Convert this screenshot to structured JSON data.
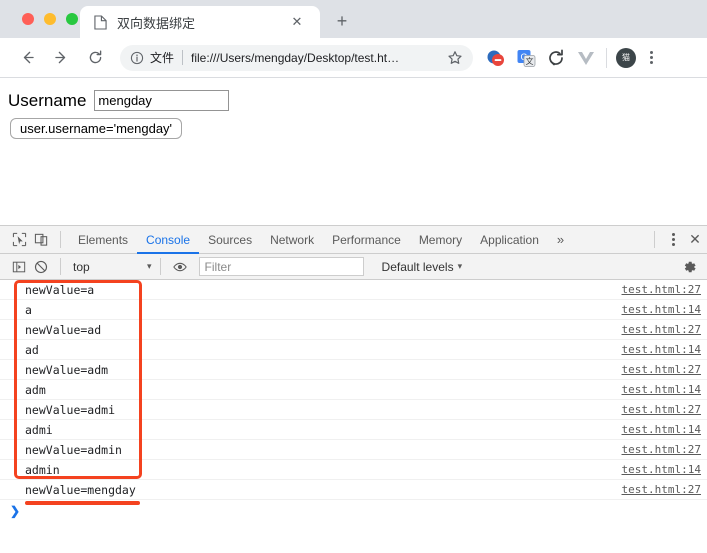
{
  "browser": {
    "tab": {
      "title": "双向数据绑定",
      "favicon_icon": "document-icon",
      "close_icon": "close-icon"
    },
    "new_tab_label": "+",
    "nav": {
      "back_icon": "arrow-left-icon",
      "forward_icon": "arrow-right-icon",
      "reload_icon": "reload-icon"
    },
    "omnibox": {
      "info_icon": "info-circle-icon",
      "scheme_label": "文件",
      "url": "file:///Users/mengday/Desktop/test.ht…",
      "star_icon": "star-icon"
    },
    "extensions": [
      {
        "name": "adblock-extension-icon"
      },
      {
        "name": "google-translate-extension-icon"
      },
      {
        "name": "refresh-extension-icon"
      },
      {
        "name": "vue-devtools-extension-icon"
      }
    ],
    "avatar_initial": "猫",
    "menu_icon": "kebab-menu-icon"
  },
  "page": {
    "username_label": "Username",
    "username_value": "mengday",
    "username_placeholder": "",
    "expression_text": "user.username='mengday'"
  },
  "devtools": {
    "inspect_icon": "inspect-element-icon",
    "device_toolbar_icon": "device-toolbar-icon",
    "tabs": [
      {
        "label": "Elements",
        "active": false
      },
      {
        "label": "Console",
        "active": true
      },
      {
        "label": "Sources",
        "active": false
      },
      {
        "label": "Network",
        "active": false
      },
      {
        "label": "Performance",
        "active": false
      },
      {
        "label": "Memory",
        "active": false
      },
      {
        "label": "Application",
        "active": false
      }
    ],
    "more_tabs_label": "»",
    "settings_menu_icon": "kebab-menu-icon",
    "close_label": "✕",
    "filterbar": {
      "sidebar_toggle_icon": "console-sidebar-icon",
      "clear_console_icon": "clear-console-icon",
      "context": "top",
      "context_caret": "▾",
      "eye_icon": "live-expression-eye-icon",
      "filter_placeholder": "Filter",
      "filter_value": "",
      "levels_label": "Default levels",
      "levels_caret": "▾",
      "gear_icon": "settings-gear-icon"
    },
    "console_rows": [
      {
        "message": "newValue=a",
        "source": "test.html:27"
      },
      {
        "message": "a",
        "source": "test.html:14"
      },
      {
        "message": "newValue=ad",
        "source": "test.html:27"
      },
      {
        "message": "ad",
        "source": "test.html:14"
      },
      {
        "message": "newValue=adm",
        "source": "test.html:27"
      },
      {
        "message": "adm",
        "source": "test.html:14"
      },
      {
        "message": "newValue=admi",
        "source": "test.html:27"
      },
      {
        "message": "admi",
        "source": "test.html:14"
      },
      {
        "message": "newValue=admin",
        "source": "test.html:27"
      },
      {
        "message": "admin",
        "source": "test.html:14"
      },
      {
        "message": "newValue=mengday",
        "source": "test.html:27"
      }
    ],
    "prompt_caret": "❯",
    "annotation_color": "#f4421f"
  }
}
